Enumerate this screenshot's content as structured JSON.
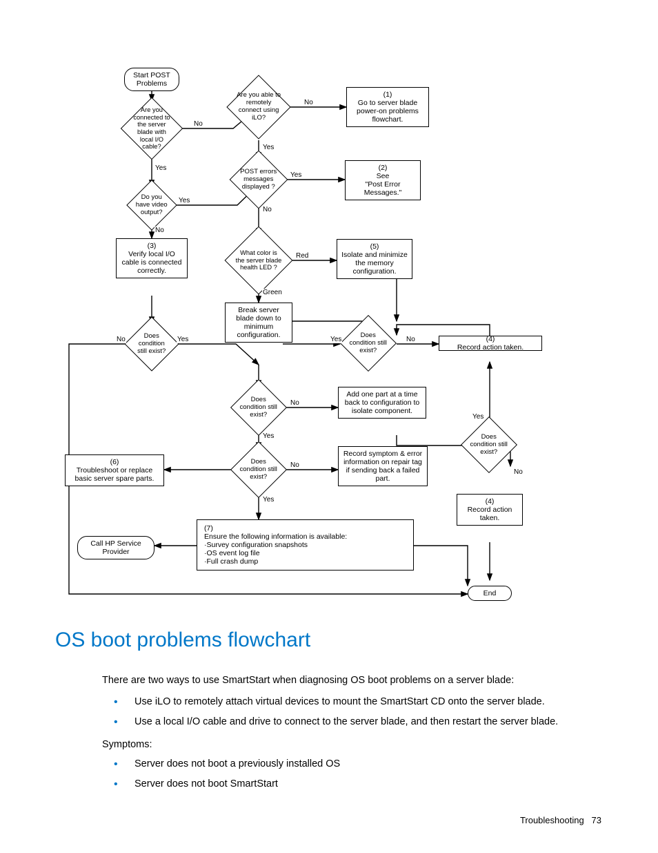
{
  "flowchart": {
    "start": "Start POST Problems",
    "d_localio": "Are you connected to the server blade with local I/O cable?",
    "d_ilo": "Are you able to remotely connect using iLO?",
    "p_poweron": "(1)\nGo to server blade power-on problems flowchart.",
    "d_video": "Do you have video output?",
    "d_posterr": "POST errors messages displayed ?",
    "p_postmsg": "(2)\nSee\n\"Post Error Messages.\"",
    "p_verifycable": "(3)\nVerify local I/O cable is connected correctly.",
    "d_healthled": "What color is the server blade health LED ?",
    "p_isolate_mem": "(5)\nIsolate and minimize the memory configuration.",
    "d_cond1": "Does condition still exist?",
    "p_breakdown": "Break server blade down to minimum configuration.",
    "d_cond_mem": "Does condition still exist?",
    "p_record4a": "(4)\nRecord action taken.",
    "d_cond_break": "Does condition still exist?",
    "p_addone": "Add one part at a time back to configuration to isolate component.",
    "p_troubleshoot": "(6)\nTroubleshoot or replace basic server spare parts.",
    "d_cond_tr": "Does condition still exist?",
    "p_recordsymptom": "Record symptom & error information on repair tag if sending back a failed part.",
    "d_cond_add": "Does condition still exist?",
    "p_record4b": "(4)\nRecord action taken.",
    "callhp": "Call HP Service Provider",
    "p_ensure": "(7)\nEnsure the following information is available:\n·Survey configuration snapshots\n·OS event log file\n·Full crash dump",
    "end": "End",
    "no": "No",
    "yes": "Yes",
    "red": "Red",
    "green": "Green"
  },
  "page": {
    "heading": "OS boot problems flowchart",
    "intro": "There are two ways to use SmartStart when diagnosing OS boot problems on a server blade:",
    "b1": "Use iLO to remotely attach virtual devices to mount the SmartStart CD onto the server blade.",
    "b2": "Use a local I/O cable and drive to connect to the server blade, and then restart the server blade.",
    "symptoms": "Symptoms:",
    "b3": "Server does not boot a previously installed OS",
    "b4": "Server does not boot SmartStart",
    "footer_section": "Troubleshooting",
    "footer_page": "73"
  }
}
